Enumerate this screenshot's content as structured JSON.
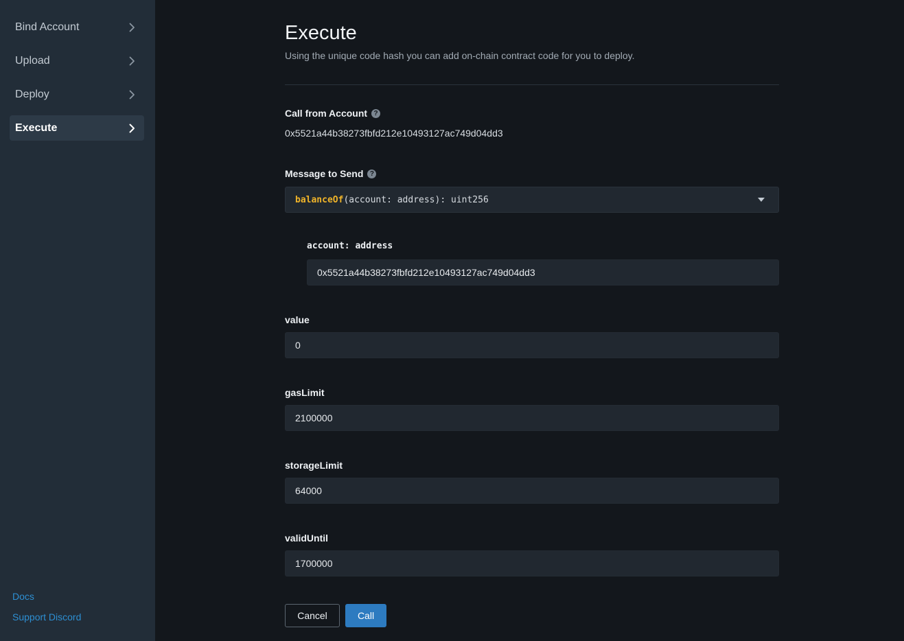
{
  "sidebar": {
    "items": [
      {
        "label": "Bind Account"
      },
      {
        "label": "Upload"
      },
      {
        "label": "Deploy"
      },
      {
        "label": "Execute"
      }
    ],
    "active_item": "Execute",
    "links": {
      "docs": "Docs",
      "support": "Support Discord"
    }
  },
  "header": {
    "title": "Execute",
    "subtitle": "Using the unique code hash you can add on-chain contract code for you to deploy."
  },
  "form": {
    "call_from": {
      "label": "Call from Account",
      "value": "0x5521a44b38273fbfd212e10493127ac749d04dd3"
    },
    "message": {
      "label": "Message to Send",
      "selected_fn_name": "balanceOf",
      "selected_fn_signature": "(account: address): uint256",
      "param_label": "account: address",
      "param_value": "0x5521a44b38273fbfd212e10493127ac749d04dd3"
    },
    "value": {
      "label": "value",
      "value": "0"
    },
    "gas_limit": {
      "label": "gasLimit",
      "value": "2100000"
    },
    "storage_limit": {
      "label": "storageLimit",
      "value": "64000"
    },
    "valid_until": {
      "label": "validUntil",
      "value": "1700000"
    }
  },
  "actions": {
    "cancel_label": "Cancel",
    "call_label": "Call"
  },
  "colors": {
    "accent": "#2d7bc0",
    "link": "#2d8fd3",
    "function_name": "#f0b429",
    "background": "#13171c",
    "sidebar": "#222d38"
  }
}
